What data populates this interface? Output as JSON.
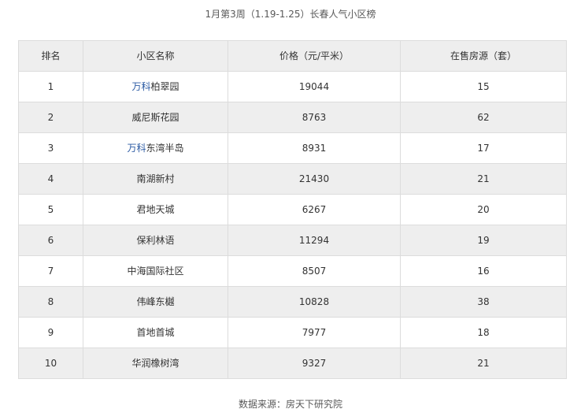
{
  "caption": "1月第3周（1.19-1.25）长春人气小区榜",
  "table": {
    "headers": [
      "排名",
      "小区名称",
      "价格（元/平米）",
      "在售房源（套）"
    ],
    "rows": [
      {
        "rank": "1",
        "name_link": "万科",
        "name_rest": "柏翠园",
        "price": "19044",
        "supply": "15"
      },
      {
        "rank": "2",
        "name_link": "",
        "name_rest": "威尼斯花园",
        "price": "8763",
        "supply": "62"
      },
      {
        "rank": "3",
        "name_link": "万科",
        "name_rest": "东湾半岛",
        "price": "8931",
        "supply": "17"
      },
      {
        "rank": "4",
        "name_link": "",
        "name_rest": "南湖新村",
        "price": "21430",
        "supply": "21"
      },
      {
        "rank": "5",
        "name_link": "",
        "name_rest": "君地天城",
        "price": "6267",
        "supply": "20"
      },
      {
        "rank": "6",
        "name_link": "",
        "name_rest": "保利林语",
        "price": "11294",
        "supply": "19"
      },
      {
        "rank": "7",
        "name_link": "",
        "name_rest": "中海国际社区",
        "price": "8507",
        "supply": "16"
      },
      {
        "rank": "8",
        "name_link": "",
        "name_rest": "伟峰东樾",
        "price": "10828",
        "supply": "38"
      },
      {
        "rank": "9",
        "name_link": "",
        "name_rest": "首地首城",
        "price": "7977",
        "supply": "18"
      },
      {
        "rank": "10",
        "name_link": "",
        "name_rest": "华润橡树湾",
        "price": "9327",
        "supply": "21"
      }
    ]
  },
  "colors": {
    "link": "#2b5aa3",
    "header_bg": "#eeeeee",
    "alt_row_bg": "#eeeeee",
    "border": "#dcdcdc"
  },
  "footer": "数据来源：房天下研究院"
}
